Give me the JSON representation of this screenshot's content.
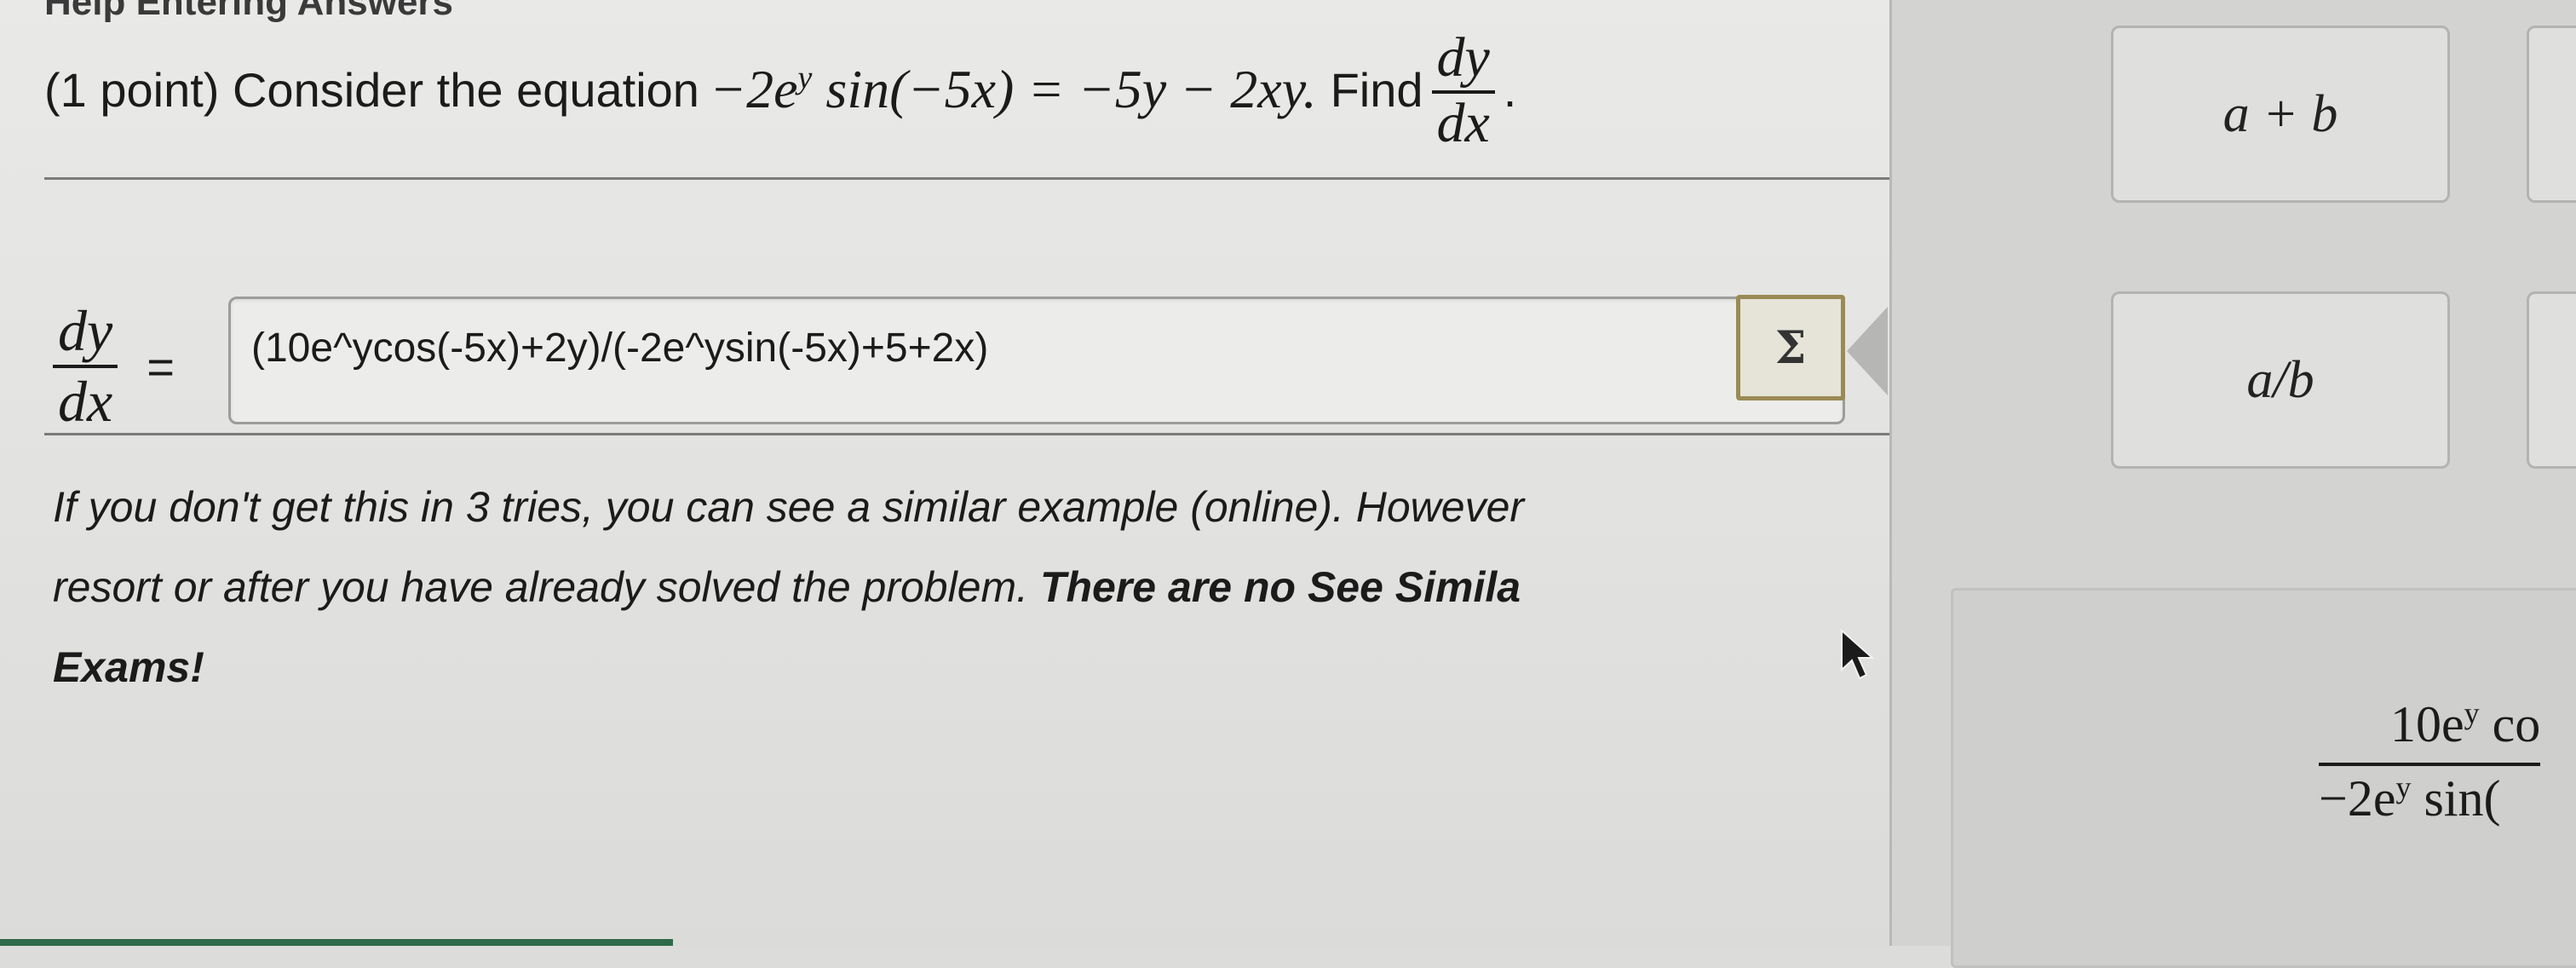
{
  "header": {
    "title_fragment": "Help Entering Answers"
  },
  "question": {
    "lead": "(1 point) Consider the equation",
    "equation_coef": "−2e",
    "equation_exp": "y",
    "equation_rest": "sin(−5x) = −5y − 2xy.",
    "find": "Find",
    "deriv_num": "dy",
    "deriv_den": "dx",
    "period": "."
  },
  "answer": {
    "label_num": "dy",
    "label_den": "dx",
    "equals": "=",
    "value": "(10e^ycos(-5x)+2y)/(-2e^ysin(-5x)+5+2x)",
    "equation_editor_symbol": "Σ"
  },
  "note": {
    "line1": "If you don't get this in 3 tries, you can see a similar example (online). However",
    "line2_normal": "resort or after you have already solved the problem.",
    "line2_bold": "There are no See Simila",
    "line3_bold": "Exams!"
  },
  "palette": {
    "buttons": [
      {
        "label": "a + b"
      },
      {
        "label": "a/b"
      }
    ]
  },
  "preview": {
    "num_coef": "10e",
    "num_exp": "y",
    "num_rest": "co",
    "den_coef": "−2e",
    "den_exp": "y",
    "den_rest": "sin("
  },
  "colors": {
    "page_bg": "#e6e6e4",
    "sigma_border": "#9a8a55",
    "accent_strip": "#2f6b4a"
  },
  "icons": {
    "equation_editor": "sigma-icon",
    "cursor": "mouse-pointer-icon"
  }
}
